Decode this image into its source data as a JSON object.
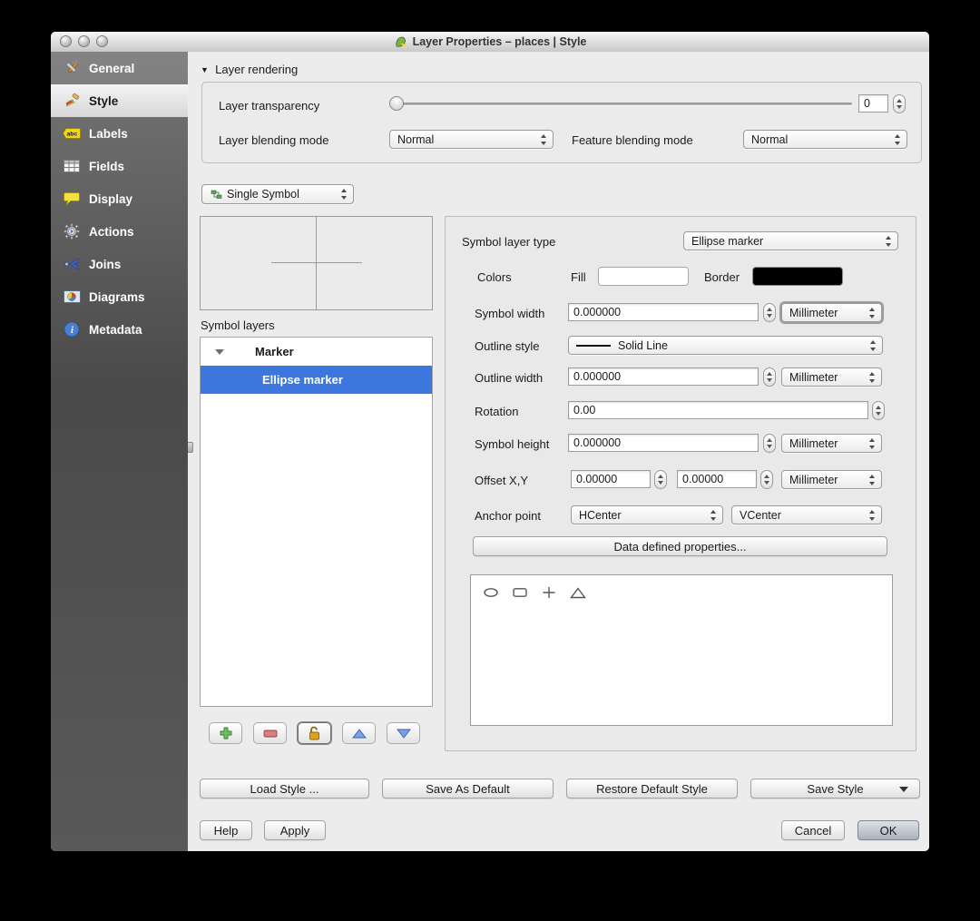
{
  "window": {
    "title": "Layer Properties – places | Style"
  },
  "sidebar": {
    "selected": "Style",
    "items": [
      {
        "label": "General",
        "icon": "tools-icon"
      },
      {
        "label": "Style",
        "icon": "paintbrush-icon"
      },
      {
        "label": "Labels",
        "icon": "abc-tag-icon"
      },
      {
        "label": "Fields",
        "icon": "table-icon"
      },
      {
        "label": "Display",
        "icon": "speech-bubble-icon"
      },
      {
        "label": "Actions",
        "icon": "gear-icon"
      },
      {
        "label": "Joins",
        "icon": "join-arrow-icon"
      },
      {
        "label": "Diagrams",
        "icon": "diagram-icon"
      },
      {
        "label": "Metadata",
        "icon": "info-icon"
      }
    ]
  },
  "layer_rendering": {
    "header": "Layer rendering",
    "transparency": {
      "label": "Layer transparency",
      "value": "0"
    },
    "layer_blending": {
      "label": "Layer blending mode",
      "value": "Normal"
    },
    "feature_blending": {
      "label": "Feature blending mode",
      "value": "Normal"
    }
  },
  "symbol_panel": {
    "renderer": "Single Symbol",
    "symbol_layers_label": "Symbol layers",
    "tree": {
      "group_label": "Marker",
      "selected_item": "Ellipse marker"
    }
  },
  "properties_panel": {
    "symbol_layer_type": {
      "label": "Symbol layer type",
      "value": "Ellipse marker"
    },
    "colors": {
      "label": "Colors",
      "fill_label": "Fill",
      "fill_color": "#ffffff",
      "border_label": "Border",
      "border_color": "#000000"
    },
    "symbol_width": {
      "label": "Symbol width",
      "value": "0.000000",
      "unit": "Millimeter"
    },
    "outline_style": {
      "label": "Outline style",
      "value": "Solid Line"
    },
    "outline_width": {
      "label": "Outline width",
      "value": "0.000000",
      "unit": "Millimeter"
    },
    "rotation": {
      "label": "Rotation",
      "value": "0.00"
    },
    "symbol_height": {
      "label": "Symbol height",
      "value": "0.000000",
      "unit": "Millimeter"
    },
    "offset": {
      "label": "Offset X,Y",
      "x_value": "0.00000",
      "y_value": "0.00000",
      "unit": "Millimeter"
    },
    "anchor": {
      "label": "Anchor point",
      "h_value": "HCenter",
      "v_value": "VCenter"
    },
    "data_defined_button": "Data defined properties...",
    "shape_options": [
      "ellipse",
      "rectangle",
      "cross",
      "triangle"
    ]
  },
  "style_buttons": {
    "load": "Load Style ...",
    "save_default": "Save As Default",
    "restore_default": "Restore Default Style",
    "save_style": "Save Style"
  },
  "dialog_buttons": {
    "help": "Help",
    "apply": "Apply",
    "cancel": "Cancel",
    "ok": "OK"
  },
  "colors": {
    "selection_blue": "#3b77dd",
    "sidebar_gray": "#565656",
    "fill_swatch": "#ffffff",
    "border_swatch": "#000000"
  }
}
